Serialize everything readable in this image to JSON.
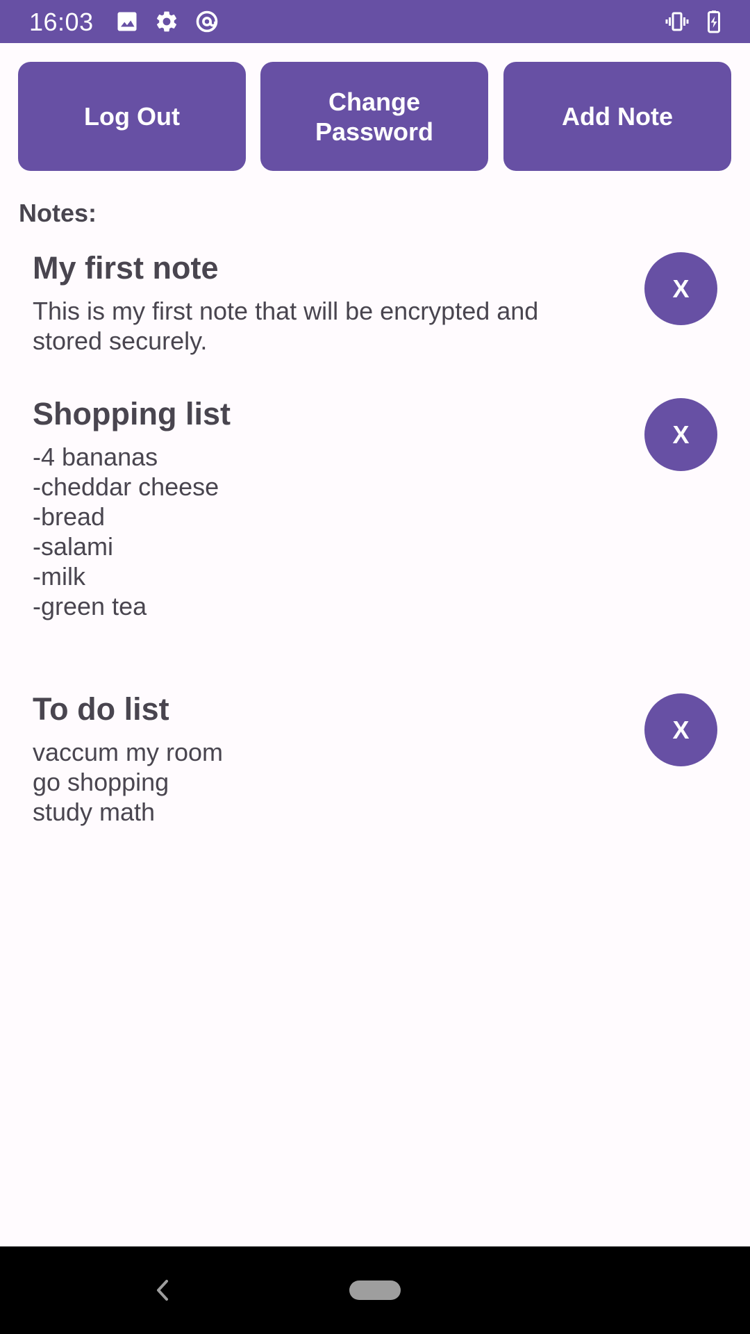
{
  "status_bar": {
    "time": "16:03",
    "icons_left": [
      "image-icon",
      "settings-gear-icon",
      "at-sign-icon"
    ],
    "icons_right": [
      "vibrate-icon",
      "battery-charging-icon"
    ]
  },
  "toolbar": {
    "logout_label": "Log Out",
    "change_password_label": "Change\nPassword",
    "add_note_label": "Add Note"
  },
  "notes_label": "Notes:",
  "notes": [
    {
      "title": "My first note",
      "body": "This is my first note that will be encrypted and\nstored securely.",
      "delete_label": "X"
    },
    {
      "title": "Shopping list",
      "body": "-4 bananas\n-cheddar cheese\n-bread\n-salami\n-milk\n-green tea",
      "delete_label": "X"
    },
    {
      "title": "To do list",
      "body": "vaccum my room\ngo shopping\nstudy math",
      "delete_label": "X"
    }
  ],
  "colors": {
    "accent": "#6750a4",
    "background": "#fffbfe",
    "text": "#49454f"
  },
  "nav_bar": {
    "icons": [
      "back-chevron-icon",
      "home-pill-icon"
    ]
  }
}
